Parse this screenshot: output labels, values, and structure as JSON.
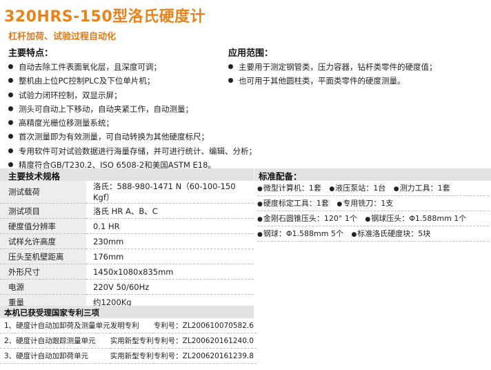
{
  "title": "320HRS-150型洛氏硬度计",
  "subtitle": "杠杆加荷、试验过程自动化",
  "features": {
    "heading": "主要特点：",
    "items": [
      "自动去除工件表面氧化层，且深度可调；",
      "整机由上位PC控制PLC及下位单片机；",
      "试验力闭环控制，双显示屏；",
      "测头可自动上下移动，自动夹紧工作，自动测量；",
      "高精度光栅位移测量系统；",
      "首次测量即为有效测量，可自动转换为其他硬度标尺；",
      "专用软件可对试验数据进行海量存储，并可进行统计、编辑、分析；",
      "精度符合GB/T230.2、ISO 6508-2和美国ASTM E18。"
    ]
  },
  "applications": {
    "heading": "应用范围：",
    "items": [
      "主要用于测定钢管类，压力容器，钻杆类零件的硬度值；",
      "也可用于其他圆柱类，平面类零件的硬度测量。"
    ]
  },
  "specs": {
    "heading": "主要技术规格",
    "rows": [
      {
        "label": "测试载荷",
        "value": "洛氏：588-980-1471 N（60-100-150 Kgf）"
      },
      {
        "label": "测试项目",
        "value": "洛氏 HR A、B、C"
      },
      {
        "label": "硬度值分辨率",
        "value": "0.1 HR"
      },
      {
        "label": "试样允许高度",
        "value": "230mm"
      },
      {
        "label": "压头至机壁距离",
        "value": "176mm"
      },
      {
        "label": "外形尺寸",
        "value": "1450x1080x835mm"
      },
      {
        "label": "电源",
        "value": "220V 50/60Hz"
      },
      {
        "label": "重量",
        "value": "约1200Kg"
      }
    ]
  },
  "standard": {
    "heading": "标准配备：",
    "rows": [
      [
        "微型计算机：1套",
        "液压泵站：1台",
        "测力工具：1套"
      ],
      [
        "硬度标定工具：1套",
        "专用铣刀：1支"
      ],
      [
        "金刚石圆锥压头：120° 1个",
        "钢球压头：Φ1.588mm 1个"
      ],
      [
        "钢球：Φ1.588mm 5个",
        "标准洛氏硬度块：5块"
      ]
    ]
  },
  "patents": {
    "heading": "本机已获受理国家专利三项",
    "rows": [
      {
        "name": "1、硬度计自动加卸荷及测量单元",
        "type": "发明专利",
        "no": "专利号：ZL200610070582.6"
      },
      {
        "name": "2、硬度计自动跟踪测量单元",
        "type": "实用新型专利",
        "no": "专利号：ZL200620161240.0"
      },
      {
        "name": "3、硬度计自动加卸荷单元",
        "type": "实用新型专利",
        "no": "专利号：ZL200620161239.8"
      }
    ]
  },
  "colors": {
    "accent": "#e8821a",
    "bar": "#e3e3e3"
  }
}
